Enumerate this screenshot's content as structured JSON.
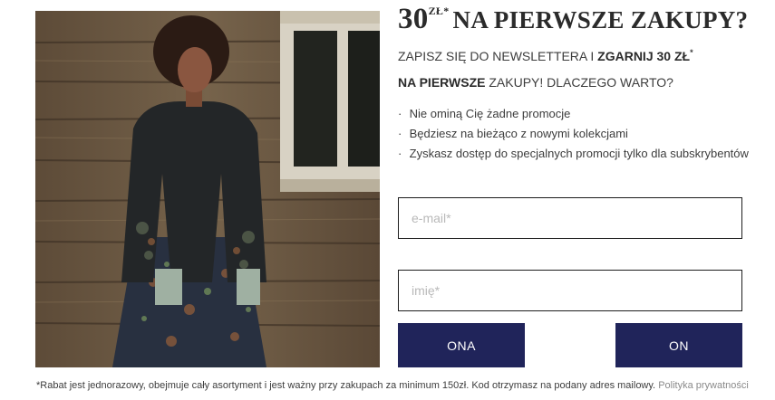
{
  "headline": {
    "amount": "30",
    "currency": "ZŁ*",
    "text": "NA PIERWSZE ZAKUPY?"
  },
  "lead": {
    "part1": "ZAPISZ SIĘ DO NEWSLETTERA I ",
    "bold1": "ZGARNIJ 30 ZŁ",
    "sup": "*",
    "bold2": "NA PIERWSZE",
    "part2": " ZAKUPY! DLACZEGO WARTO?"
  },
  "benefits": [
    {
      "bullet": "·",
      "text": "Nie ominą Cię żadne promocje"
    },
    {
      "bullet": "·",
      "text": "Będziesz na bieżąco z nowymi kolekcjami"
    },
    {
      "bullet": "·",
      "text": "Zyskasz dostęp do specjalnych promocji tylko dla subskrybentów"
    }
  ],
  "form": {
    "email_placeholder": "e-mail*",
    "email_value": "",
    "name_placeholder": "imię*",
    "name_value": ""
  },
  "buttons": {
    "ona": "ONA",
    "on": "ON"
  },
  "footnote": {
    "text": "*Rabat jest jednorazowy, obejmuje cały asortyment i jest ważny przy zakupach za minimum 150zł. Kod otrzymasz na podany adres mailowy. ",
    "link": "Polityka prywatności"
  },
  "colors": {
    "button_bg": "#20245a",
    "button_text": "#ffffff",
    "border": "#1d1d1d",
    "link": "#8a8a8a"
  }
}
